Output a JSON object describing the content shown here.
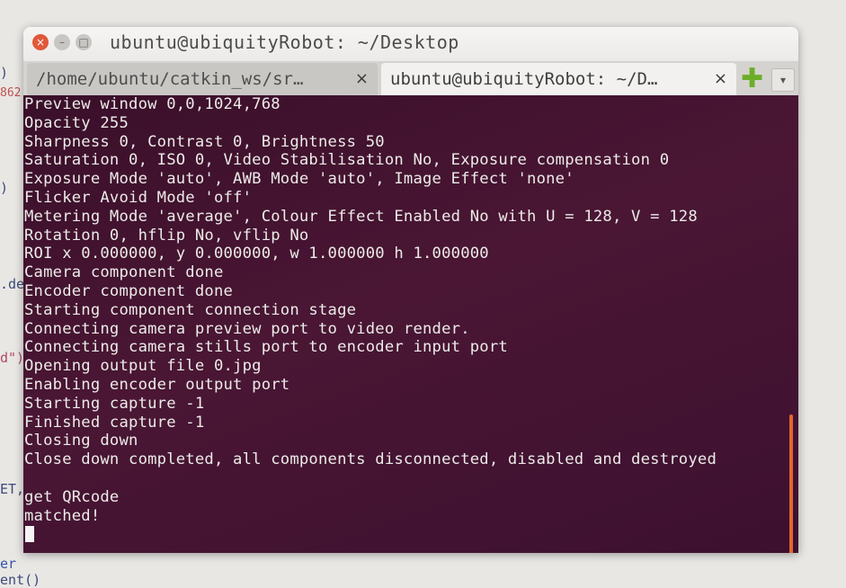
{
  "background": {
    "fragments": [
      ")",
      "862",
      ")",
      ".de",
      "d\")",
      "ET,",
      "er",
      "ent()"
    ]
  },
  "window": {
    "title": "ubuntu@ubiquityRobot: ~/Desktop",
    "controls": {
      "close": "×",
      "minimize": "–",
      "maximize": "□"
    },
    "tabs": [
      {
        "label": "/home/ubuntu/catkin_ws/sr…",
        "close": "×"
      },
      {
        "label": "ubuntu@ubiquityRobot: ~/D…",
        "close": "×"
      }
    ],
    "new_tab": "✚",
    "tab_menu": "▾"
  },
  "terminal": {
    "lines": [
      "Preview window 0,0,1024,768",
      "Opacity 255",
      "Sharpness 0, Contrast 0, Brightness 50",
      "Saturation 0, ISO 0, Video Stabilisation No, Exposure compensation 0",
      "Exposure Mode 'auto', AWB Mode 'auto', Image Effect 'none'",
      "Flicker Avoid Mode 'off'",
      "Metering Mode 'average', Colour Effect Enabled No with U = 128, V = 128",
      "Rotation 0, hflip No, vflip No",
      "ROI x 0.000000, y 0.000000, w 1.000000 h 1.000000",
      "Camera component done",
      "Encoder component done",
      "Starting component connection stage",
      "Connecting camera preview port to video render.",
      "Connecting camera stills port to encoder input port",
      "Opening output file 0.jpg",
      "Enabling encoder output port",
      "Starting capture -1",
      "Finished capture -1",
      "Closing down",
      "Close down completed, all components disconnected, disabled and destroyed",
      "",
      "get QRcode",
      "matched!"
    ],
    "colors": {
      "background": "#3d1030",
      "text": "#ecebe8",
      "scrollbar": "#e1682c"
    }
  }
}
